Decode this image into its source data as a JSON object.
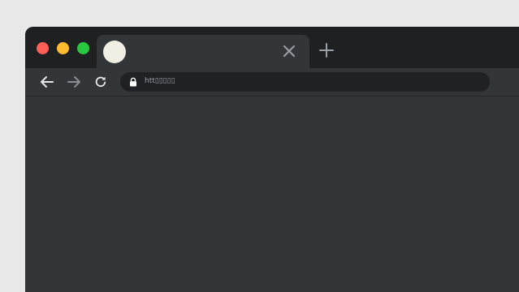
{
  "window": {
    "traffic_lights": {
      "close_color": "#ff5f57",
      "minimize_color": "#febc2e",
      "maximize_color": "#28c840"
    }
  },
  "tab": {
    "title": "",
    "favicon_color": "#f1eee4",
    "close_icon": "close-icon"
  },
  "toolbar": {
    "back_icon": "arrow-left-icon",
    "forward_icon": "arrow-right-icon",
    "reload_icon": "reload-icon",
    "address": {
      "lock_icon": "lock-icon",
      "url": "htt▯▯▯▯▯"
    }
  },
  "colors": {
    "tabstrip": "#1f2022",
    "toolbar": "#323639",
    "omnibox": "#202124",
    "icon_active": "#e8eaed",
    "icon_inactive": "#8a8d91",
    "tab_close_icon": "#9aa0a6"
  }
}
